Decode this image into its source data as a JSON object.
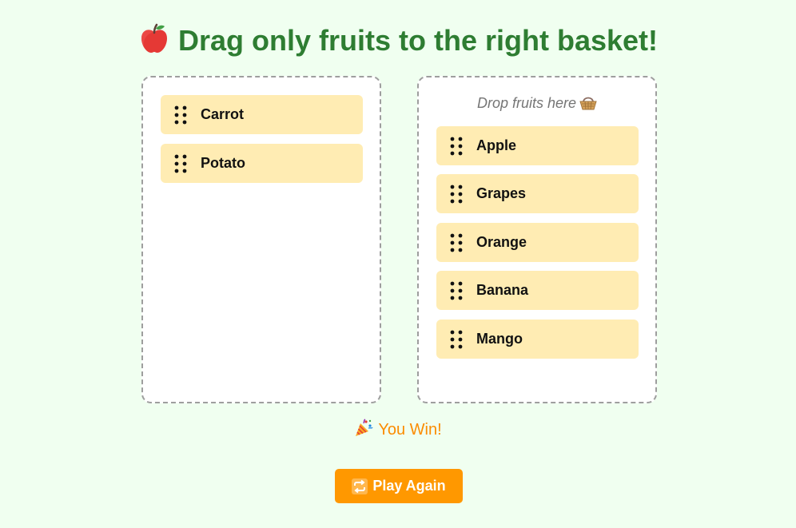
{
  "title": {
    "text": "Drag only fruits to the right basket!",
    "icon": "apple-icon"
  },
  "left_basket": {
    "items": [
      {
        "label": "Carrot"
      },
      {
        "label": "Potato"
      }
    ]
  },
  "right_basket": {
    "hint": "Drop fruits here",
    "hint_icon": "basket-icon",
    "items": [
      {
        "label": "Apple"
      },
      {
        "label": "Grapes"
      },
      {
        "label": "Orange"
      },
      {
        "label": "Banana"
      },
      {
        "label": "Mango"
      }
    ]
  },
  "status": {
    "text": "You Win!",
    "icon": "party-popper-icon"
  },
  "play_again": {
    "label": "Play Again",
    "icon": "repeat-icon"
  },
  "colors": {
    "background": "#f0fff0",
    "title": "#2e7d32",
    "item": "#ffecb3",
    "accent": "#ff9800",
    "status": "#fb8c00"
  }
}
